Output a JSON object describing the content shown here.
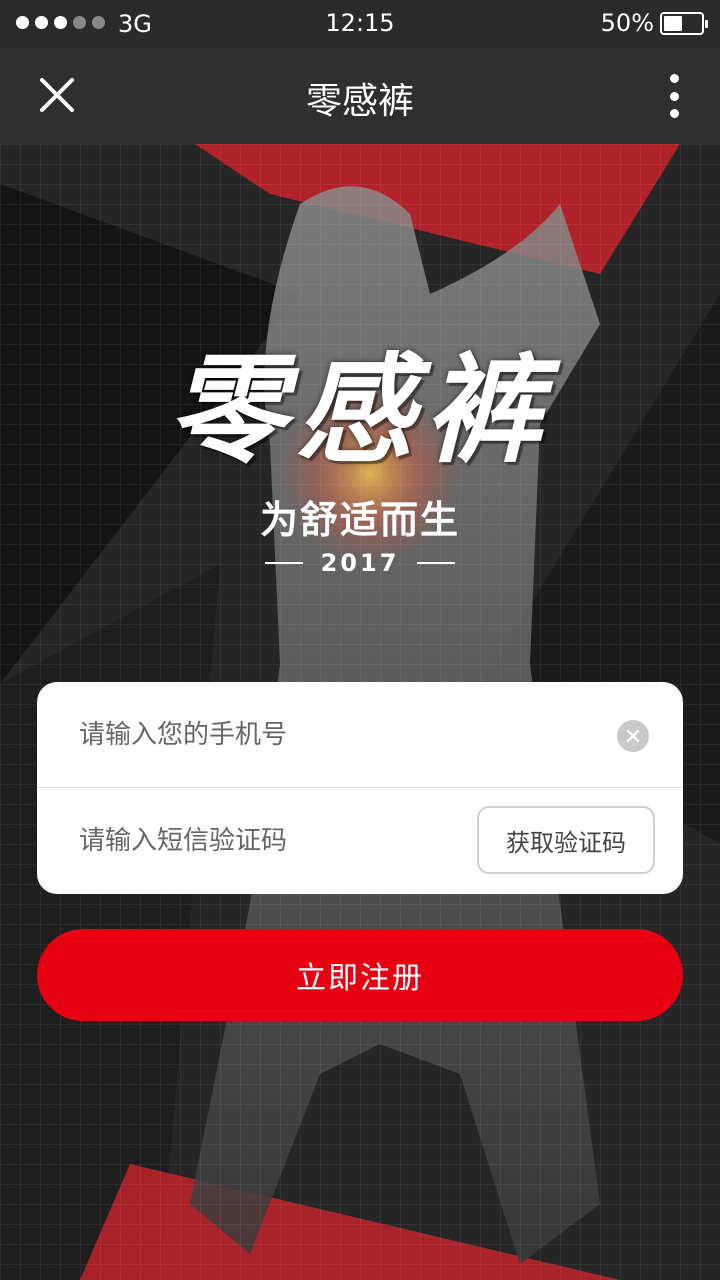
{
  "status_bar": {
    "carrier": "3G",
    "time": "12:15",
    "battery_percent_text": "50%",
    "battery_level": 0.5,
    "signal_strength": 3,
    "signal_max": 5
  },
  "nav": {
    "title": "零感裤",
    "close_icon": "close-icon",
    "more_icon": "more-vertical-icon"
  },
  "hero": {
    "brand_title": "零感裤",
    "slogan": "为舒适而生",
    "year": "2017"
  },
  "form": {
    "phone_placeholder": "请输入您的手机号",
    "phone_value": "",
    "code_placeholder": "请输入短信验证码",
    "code_value": "",
    "get_code_label": "获取验证码",
    "clear_icon": "clear-icon"
  },
  "register_label": "立即注册",
  "colors": {
    "accent_red": "#e60012",
    "hero_red": "#c0232b",
    "header_bg": "#2f2f2f"
  }
}
